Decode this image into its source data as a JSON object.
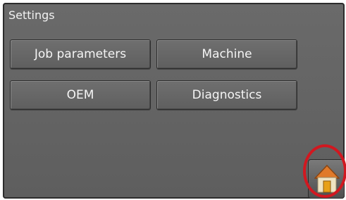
{
  "header": {
    "title": "Settings"
  },
  "menu": {
    "job_parameters": "Job parameters",
    "machine": "Machine",
    "oem": "OEM",
    "diagnostics": "Diagnostics"
  },
  "home_button": {
    "icon": "home-icon"
  },
  "colors": {
    "screen_bg": "#636363",
    "button_bg": "#676767",
    "text": "#f5f5f5",
    "highlight": "#d11820",
    "home_roof": "#e07a2a",
    "home_wall": "#efe3c2",
    "home_door": "#e7a018"
  }
}
